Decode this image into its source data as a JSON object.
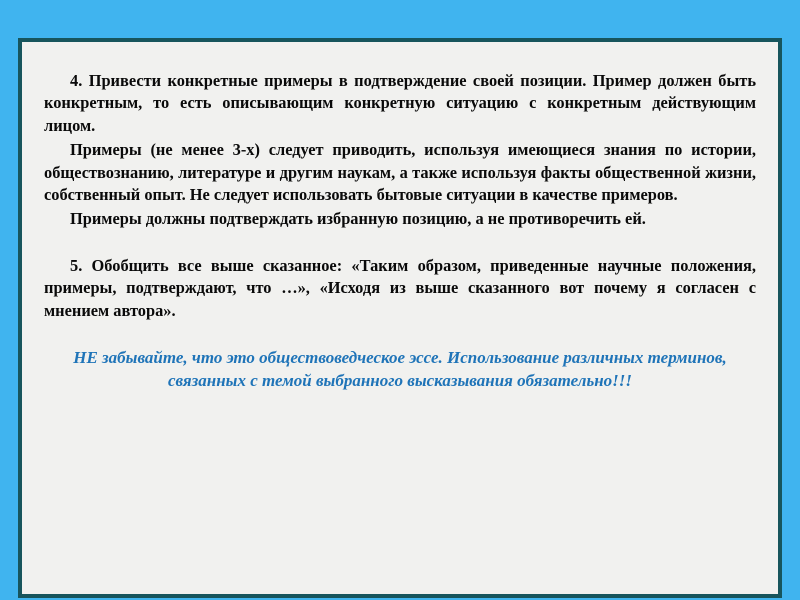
{
  "slide": {
    "background_color": "#40b4ef",
    "frame_border_color": "#17555c",
    "frame_background_color": "#f1f1ef",
    "decoration": {
      "name": "mosaic-corner-decoration",
      "position": "top-right",
      "colors": [
        "#0f3b76",
        "#1e5fa8",
        "#3a8fd0",
        "#62b6e6",
        "#9ad6f2",
        "#cfeaf9",
        "#ffffff"
      ]
    },
    "body": {
      "paragraphs": [
        "4. Привести конкретные примеры в подтверждение своей позиции. Пример должен быть конкретным, то есть описывающим конкретную ситуацию с конкретным действующим лицом.",
        "Примеры (не менее 3-х) следует приводить, используя имеющиеся знания по истории, обществознанию, литературе и другим наукам, а также используя факты общественной жизни, собственный опыт. Не следует использовать бытовые ситуации в качестве примеров.",
        "Примеры должны подтверждать избранную позицию, а не противоречить ей.",
        "5. Обобщить все выше сказанное: «Таким образом, приведенные научные положения, примеры, подтверждают, что …», «Исходя из выше сказанного вот почему я согласен с мнением автора»."
      ],
      "highlight_note": "НЕ забывайте, что это обществоведческое эссе. Использование различных терминов, связанных с темой выбранного высказывания обязательно!!!",
      "highlight_color": "#1f74b8"
    }
  }
}
